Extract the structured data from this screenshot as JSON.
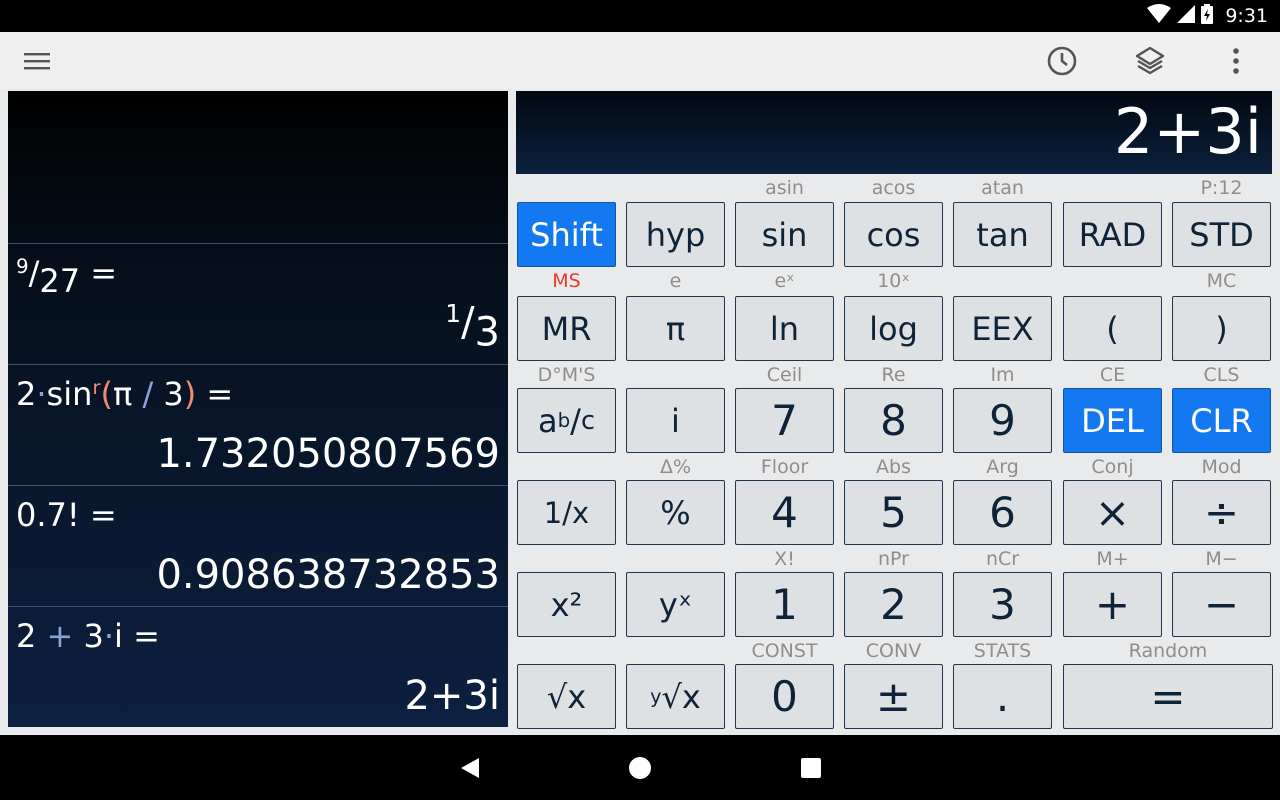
{
  "status_bar": {
    "time": "9:31"
  },
  "toolbar": {
    "icons": [
      "menu-icon",
      "history-clock-icon",
      "layers-icon",
      "more-vert-icon"
    ]
  },
  "history": {
    "entries": [
      {
        "expr": {
          "num": "9",
          "den": "27",
          "suffix": " ="
        },
        "result": {
          "num": "1",
          "den": "3"
        }
      },
      {
        "expr": {
          "a": "2",
          "func": "sin",
          "mode": "r",
          "lp": "(",
          "pi": "π",
          "slash": "/",
          "three": "3",
          "rp": ")",
          "suffix": " ="
        },
        "result": "1.732050807569"
      },
      {
        "expr": "0.7! =",
        "result": "0.908638732853"
      },
      {
        "expr": {
          "a": "2",
          "plus": "+",
          "b": "3",
          "i": "i",
          "suffix": " ="
        },
        "result": "2+3i"
      }
    ]
  },
  "display": {
    "value": "2+3i"
  },
  "keypad": {
    "rows": [
      {
        "labels": [
          "",
          "",
          "asin",
          "acos",
          "atan",
          "",
          "P:12"
        ],
        "keys": [
          "Shift",
          "hyp",
          "sin",
          "cos",
          "tan",
          "RAD",
          "STD"
        ]
      },
      {
        "labels": [
          "MS",
          "e",
          "eˣ",
          "10ˣ",
          "",
          "",
          "MC"
        ],
        "keys": [
          "MR",
          "π",
          "ln",
          "log",
          "EEX",
          "(",
          ")"
        ]
      },
      {
        "labels": [
          "D°M'S",
          "",
          "Ceil",
          "Re",
          "Im",
          "CE",
          "CLS"
        ],
        "keys": [
          "abc",
          "i",
          "7",
          "8",
          "9",
          "DEL",
          "CLR"
        ]
      },
      {
        "labels": [
          "",
          "Δ%",
          "Floor",
          "Abs",
          "Arg",
          "Conj",
          "Mod"
        ],
        "keys": [
          "1/x",
          "%",
          "4",
          "5",
          "6",
          "×",
          "÷"
        ]
      },
      {
        "labels": [
          "",
          "",
          "X!",
          "nPr",
          "nCr",
          "M+",
          "M−"
        ],
        "keys": [
          "x²",
          "yˣ",
          "1",
          "2",
          "3",
          "+",
          "−"
        ]
      },
      {
        "labels": [
          "",
          "",
          "CONST",
          "CONV",
          "STATS",
          "Random"
        ],
        "keys": [
          "√x",
          "y√x",
          "0",
          "±",
          ".",
          "="
        ]
      }
    ],
    "fraction_key": {
      "a": "a",
      "b": "b",
      "c": "c"
    },
    "root_key": {
      "index": "y",
      "radical": "√x"
    },
    "accent_color": "#1478f0",
    "memory_label_color": "#f2372d"
  }
}
